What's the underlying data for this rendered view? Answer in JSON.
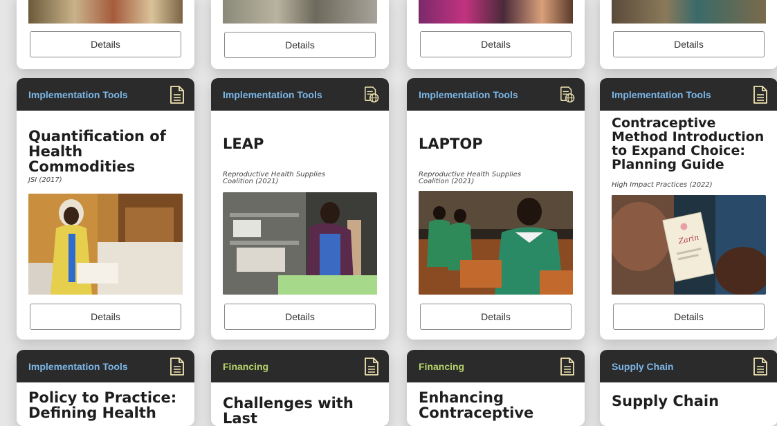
{
  "colors": {
    "header_bg": "#2b2b2b",
    "implementation_tools": "#7cb7e8",
    "financing": "#b5d46a",
    "supply_chain": "#7cb7e8"
  },
  "top_row": [
    {
      "button": "Details"
    },
    {
      "button": "Details"
    },
    {
      "button": "Details"
    },
    {
      "button": "Details"
    }
  ],
  "middle_row": [
    {
      "category": "Implementation Tools",
      "icon": "document-icon",
      "title_lines": [
        "Quantification of",
        "Health Commodities"
      ],
      "author": "JSI (2017)",
      "button": "Details"
    },
    {
      "category": "Implementation Tools",
      "icon": "web-tool-icon",
      "title_lines": [
        "LEAP"
      ],
      "author_lines": [
        "Reproductive Health Supplies",
        "Coalition (2021)"
      ],
      "button": "Details"
    },
    {
      "category": "Implementation Tools",
      "icon": "web-tool-icon",
      "title_lines": [
        "LAPTOP"
      ],
      "author_lines": [
        "Reproductive Health Supplies",
        "Coalition (2021)"
      ],
      "button": "Details"
    },
    {
      "category": "Implementation Tools",
      "icon": "document-icon",
      "title_lines": [
        "Contraceptive",
        "Method Introduction",
        "to Expand Choice:",
        "Planning Guide"
      ],
      "author": "High Impact Practices (2022)",
      "button": "Details"
    }
  ],
  "bottom_row": [
    {
      "category": "Implementation Tools",
      "icon": "document-icon",
      "title_lines": [
        "Policy to Practice:",
        "Defining Health"
      ]
    },
    {
      "category": "Financing",
      "icon": "document-icon",
      "title_lines": [
        "Challenges with Last"
      ]
    },
    {
      "category": "Financing",
      "icon": "document-icon",
      "title_lines": [
        "Enhancing",
        "Contraceptive"
      ]
    },
    {
      "category": "Supply Chain",
      "icon": "document-icon",
      "title_lines": [
        "Supply Chain"
      ]
    }
  ]
}
